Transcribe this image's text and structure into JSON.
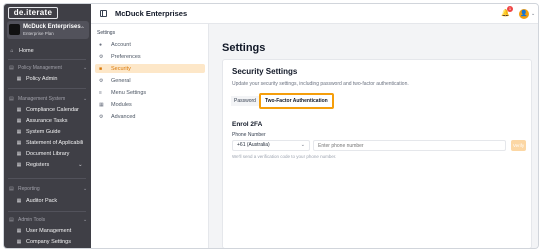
{
  "app": {
    "logo": "de.iterate"
  },
  "org": {
    "name": "McDuck Enterprises",
    "plan": "Enterprise Plan"
  },
  "sidebar": {
    "home": "Home",
    "policy_section": "Policy Management",
    "policy_admin": "Policy Admin",
    "management_section": "Management System",
    "items": [
      "Compliance Calendar",
      "Assurance Tasks",
      "System Guide",
      "Statement of Applicabili",
      "Document Library",
      "Registers"
    ],
    "reporting_section": "Reporting",
    "auditor_pack": "Auditor Pack",
    "admin_section": "Admin Tools",
    "user_management": "User Management",
    "company_settings": "Company Settings"
  },
  "header": {
    "title": "McDuck Enterprises",
    "notification_count": "1",
    "avatar_initial": "👤"
  },
  "settings_nav": {
    "title": "Settings",
    "items": [
      "Account",
      "Preferences",
      "Security",
      "General",
      "Menu Settings",
      "Modules",
      "Advanced"
    ],
    "active_index": 2
  },
  "main": {
    "page_title": "Settings",
    "card_title": "Security Settings",
    "card_desc": "Update your security settings, including password and two-factor authentication.",
    "tabs": [
      "Password",
      "Two-Factor Authentication"
    ],
    "active_tab": 1,
    "enrol_title": "Enrol 2FA",
    "phone_label": "Phone Number",
    "country_value": "+61 (Australia)",
    "phone_placeholder": "Enter phone number",
    "verify_label": "Verify",
    "hint": "We'll send a verification code to your phone number."
  },
  "colors": {
    "accent": "#f59e0b",
    "sidebar_bg": "#3f3f46",
    "active_nav_bg": "#fde7c8"
  },
  "icons": {
    "home": "home-icon",
    "bell": "bell-icon",
    "panel": "sidebar-toggle-icon",
    "account": "user-icon",
    "preferences": "sliders-icon",
    "security": "lock-icon",
    "general": "gear-icon",
    "menu": "menu-icon",
    "modules": "grid-icon",
    "advanced": "gear-icon"
  }
}
